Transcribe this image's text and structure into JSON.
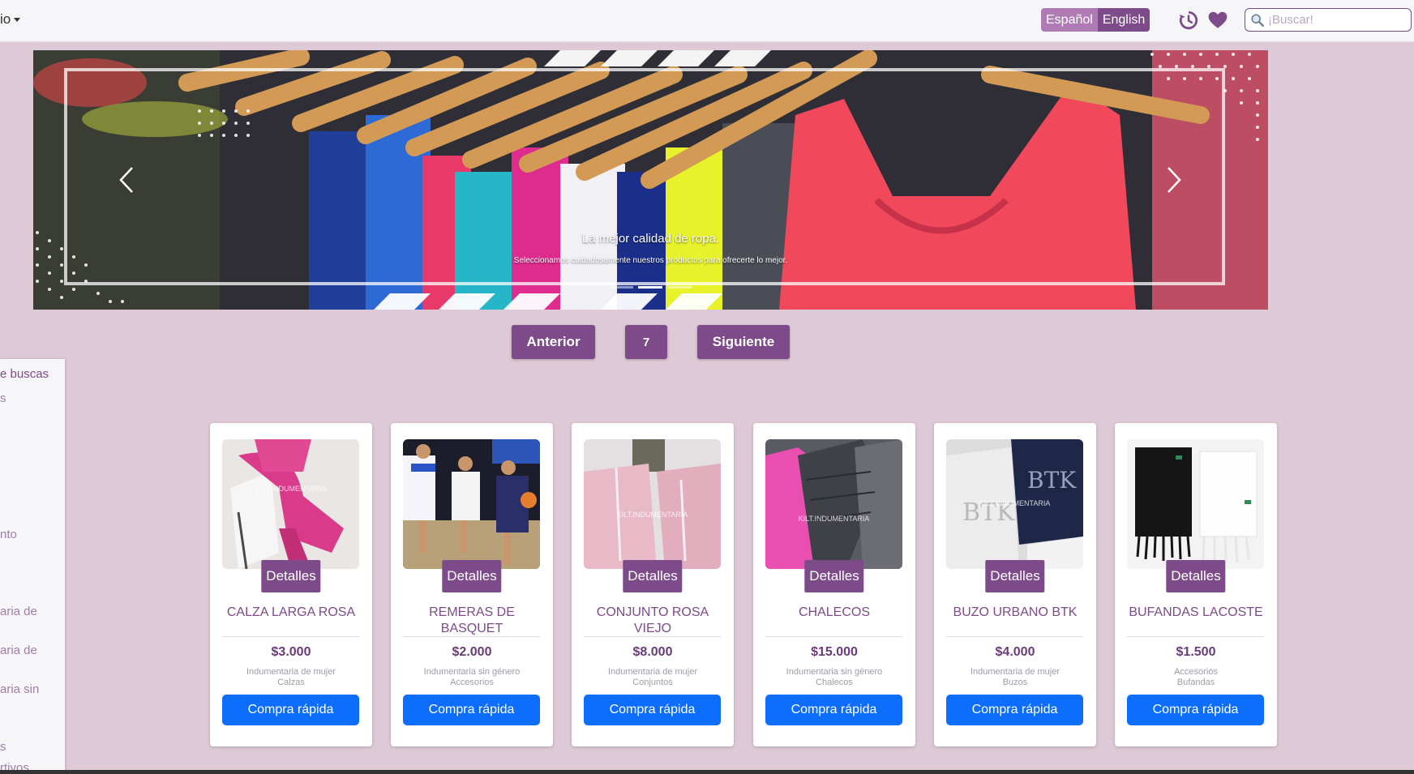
{
  "navbar": {
    "user_menu_label": "io",
    "languages": [
      "Español",
      "English"
    ],
    "search_placeholder": "¡Buscar!"
  },
  "hero": {
    "title": "La mejor calidad de ropa.",
    "subtitle": "Seleccionamos cuidadosamente nuestros productos para ofrecerte lo mejor.",
    "slide_count": 3,
    "active_slide": 1
  },
  "pagination": {
    "prev_label": "Anterior",
    "current_page": "7",
    "next_label": "Siguiente"
  },
  "sidebar": {
    "items": [
      "e buscas",
      "s",
      "nto",
      "aria de",
      "aria de",
      "aria sin",
      "s",
      "rtivos"
    ]
  },
  "watermark": "KILT.INDUMENTARIA",
  "products": [
    {
      "details_label": "Detalles",
      "name": "CALZA LARGA ROSA",
      "price": "$3.000",
      "category": "Indumentaria de mujer",
      "subcategory": "Calzas",
      "buy_label": "Compra rápida"
    },
    {
      "details_label": "Detalles",
      "name": "REMERAS DE BASQUET",
      "price": "$2.000",
      "category": "Indumentaria sin género",
      "subcategory": "Accesorios",
      "buy_label": "Compra rápida"
    },
    {
      "details_label": "Detalles",
      "name": "CONJUNTO ROSA VIEJO",
      "price": "$8.000",
      "category": "Indumentaria de mujer",
      "subcategory": "Conjuntos",
      "buy_label": "Compra rápida"
    },
    {
      "details_label": "Detalles",
      "name": "CHALECOS",
      "price": "$15.000",
      "category": "Indumentaria sin género",
      "subcategory": "Chalecos",
      "buy_label": "Compra rápida"
    },
    {
      "details_label": "Detalles",
      "name": "BUZO URBANO BTK",
      "price": "$4.000",
      "category": "Indumentaria de mujer",
      "subcategory": "Buzos",
      "buy_label": "Compra rápida"
    },
    {
      "details_label": "Detalles",
      "name": "BUFANDAS LACOSTE",
      "price": "$1.500",
      "category": "Accesorios",
      "subcategory": "Bufandas",
      "buy_label": "Compra rápida"
    }
  ],
  "colors": {
    "page_bg": "#decad6",
    "brand_purple": "#7d4a8a",
    "lang_inactive": "#b07bb4",
    "buy_blue": "#0d6efd"
  },
  "icons": [
    "history-icon",
    "heart-icon",
    "search-icon",
    "chevron-left-icon",
    "chevron-right-icon"
  ]
}
